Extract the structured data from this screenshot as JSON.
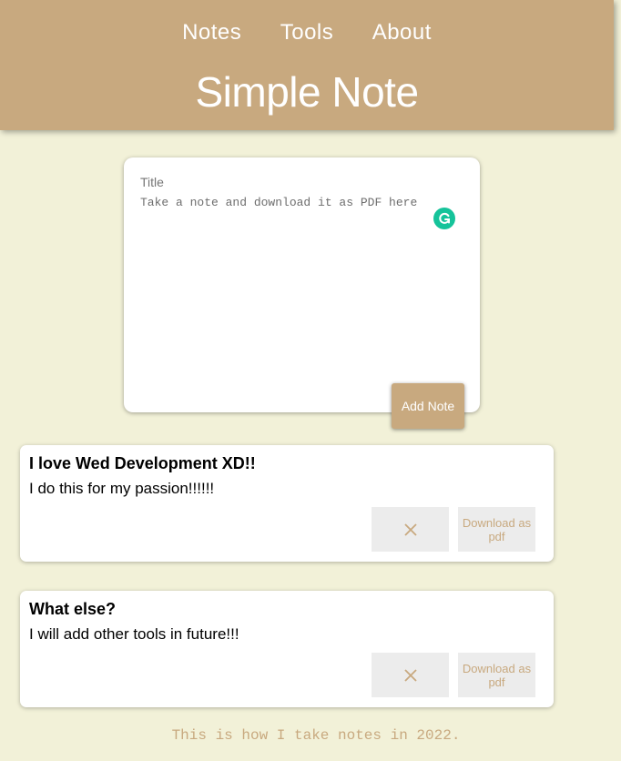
{
  "nav": {
    "items": [
      "Notes",
      "Tools",
      "About"
    ]
  },
  "header": {
    "title": "Simple Note"
  },
  "composer": {
    "title_placeholder": "Title",
    "body_placeholder": "Take a note and download it as PDF here",
    "add_label": "Add Note"
  },
  "notes": [
    {
      "title": "I love Wed Development XD!!",
      "body": "I do this for my passion!!!!!!",
      "download_label": "Download as pdf"
    },
    {
      "title": "What else?",
      "body": "I will add other tools in future!!!",
      "download_label": "Download as pdf"
    }
  ],
  "footer": {
    "text": "This is how I take notes in 2022."
  },
  "colors": {
    "accent": "#c8a97f",
    "background": "#f2f1d8",
    "grammarly": "#15c39a"
  },
  "icons": {
    "delete": "close-icon",
    "assistant": "grammarly-icon"
  }
}
